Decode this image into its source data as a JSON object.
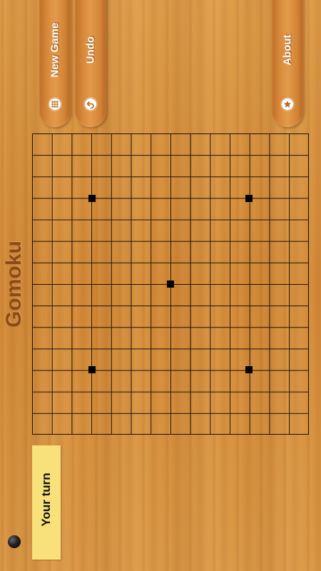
{
  "app": {
    "title": "Gomoku"
  },
  "toolbar": {
    "new_game_label": "New Game",
    "undo_label": "Undo",
    "about_label": "About"
  },
  "board": {
    "columns": 14,
    "rows": 14,
    "line_color": "#1d120a",
    "star_points": [
      {
        "col": 3,
        "row": 3
      },
      {
        "col": 11,
        "row": 3
      },
      {
        "col": 7,
        "row": 7
      },
      {
        "col": 3,
        "row": 11
      },
      {
        "col": 11,
        "row": 11
      }
    ]
  },
  "status": {
    "text": "Your turn",
    "stone_color": "black",
    "panel_color": "#f8e17a"
  },
  "colors": {
    "wood": "#d8913c",
    "button": "#d7893b",
    "title": "#8a4a1a"
  }
}
